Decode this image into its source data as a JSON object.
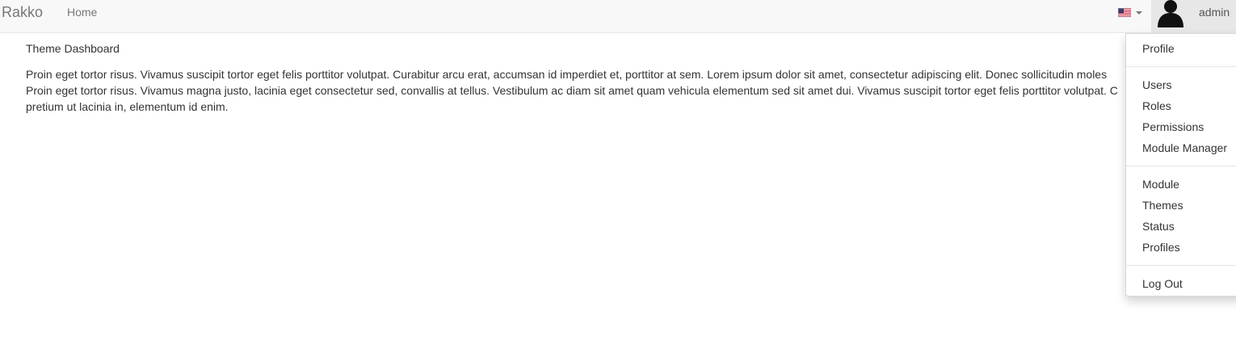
{
  "navbar": {
    "brand": "Rakko",
    "home_label": "Home",
    "language_icon": "us-flag-icon",
    "user_name": "admin",
    "avatar_icon": "user-avatar-icon"
  },
  "content": {
    "title": "Theme Dashboard",
    "lines": [
      "Proin eget tortor risus. Vivamus suscipit tortor eget felis porttitor volutpat. Curabitur arcu erat, accumsan id imperdiet et, porttitor at sem. Lorem ipsum dolor sit amet, consectetur adipiscing elit. Donec sollicitudin moles",
      "Proin eget tortor risus. Vivamus magna justo, lacinia eget consectetur sed, convallis at tellus. Vestibulum ac diam sit amet quam vehicula elementum sed sit amet dui. Vivamus suscipit tortor eget felis porttitor volutpat. C",
      "pretium ut lacinia in, elementum id enim."
    ]
  },
  "user_menu": {
    "profile": "Profile",
    "users": "Users",
    "roles": "Roles",
    "permissions": "Permissions",
    "module_manager": "Module Manager",
    "module": "Module",
    "themes": "Themes",
    "status": "Status",
    "profiles": "Profiles",
    "log_out": "Log Out"
  },
  "colors": {
    "navbar_bg": "#f8f8f8",
    "navbar_text": "#777777",
    "active_toggle_bg": "#e7e7e7",
    "text": "#333333"
  }
}
